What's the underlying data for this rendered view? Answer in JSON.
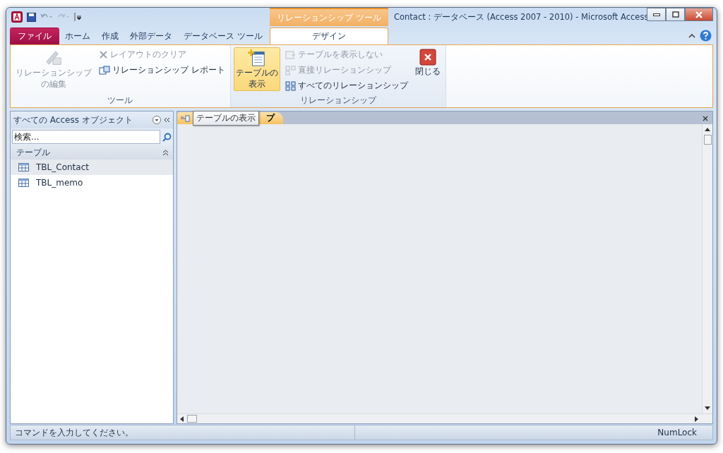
{
  "window": {
    "title": "Contact : データベース (Access 2007 - 2010)  -  Microsoft Access"
  },
  "contextual_group": {
    "label": "リレーションシップ ツール"
  },
  "tabs": [
    {
      "label": "ファイル",
      "kind": "file",
      "selected": false
    },
    {
      "label": "ホーム",
      "kind": "normal",
      "selected": false
    },
    {
      "label": "作成",
      "kind": "normal",
      "selected": false
    },
    {
      "label": "外部データ",
      "kind": "normal",
      "selected": false
    },
    {
      "label": "データベース ツール",
      "kind": "normal",
      "selected": false
    },
    {
      "label": "デザイン",
      "kind": "contextual",
      "selected": true
    }
  ],
  "ribbon_groups": [
    {
      "label": "ツール",
      "items": [
        {
          "kind": "large",
          "lines": [
            "リレーションシップ",
            "の編集"
          ],
          "disabled": true,
          "hovered": false
        },
        {
          "kind": "small",
          "lines": [
            "レイアウトのクリア"
          ],
          "disabled": true,
          "hovered": false
        },
        {
          "kind": "small",
          "lines": [
            "リレーションシップ レポート"
          ],
          "disabled": false,
          "hovered": false
        }
      ]
    },
    {
      "label": "リレーションシップ",
      "items": [
        {
          "kind": "large",
          "lines": [
            "テーブルの",
            "表示"
          ],
          "disabled": false,
          "hovered": true
        },
        {
          "kind": "small",
          "lines": [
            "テーブルを表示しない"
          ],
          "disabled": true,
          "hovered": false
        },
        {
          "kind": "small",
          "lines": [
            "直接リレーションシップ"
          ],
          "disabled": true,
          "hovered": false
        },
        {
          "kind": "small",
          "lines": [
            "すべてのリレーションシップ"
          ],
          "disabled": false,
          "hovered": false
        },
        {
          "kind": "large",
          "lines": [
            "閉じる"
          ],
          "disabled": false,
          "hovered": false
        }
      ]
    }
  ],
  "nav_pane": {
    "title": "すべての Access オブジェクト",
    "search": {
      "placeholder": "検索..."
    },
    "sections": [
      {
        "label": "テーブル",
        "expanded": true,
        "items": [
          {
            "label": "TBL_Contact",
            "selected": true
          },
          {
            "label": "TBL_memo",
            "selected": false
          }
        ]
      }
    ]
  },
  "document_tab": {
    "label": "プ",
    "selected": true
  },
  "tooltip": {
    "text": "テーブルの表示"
  },
  "status_bar": {
    "message": "コマンドを入力してください。",
    "indicator": "NumLock"
  }
}
